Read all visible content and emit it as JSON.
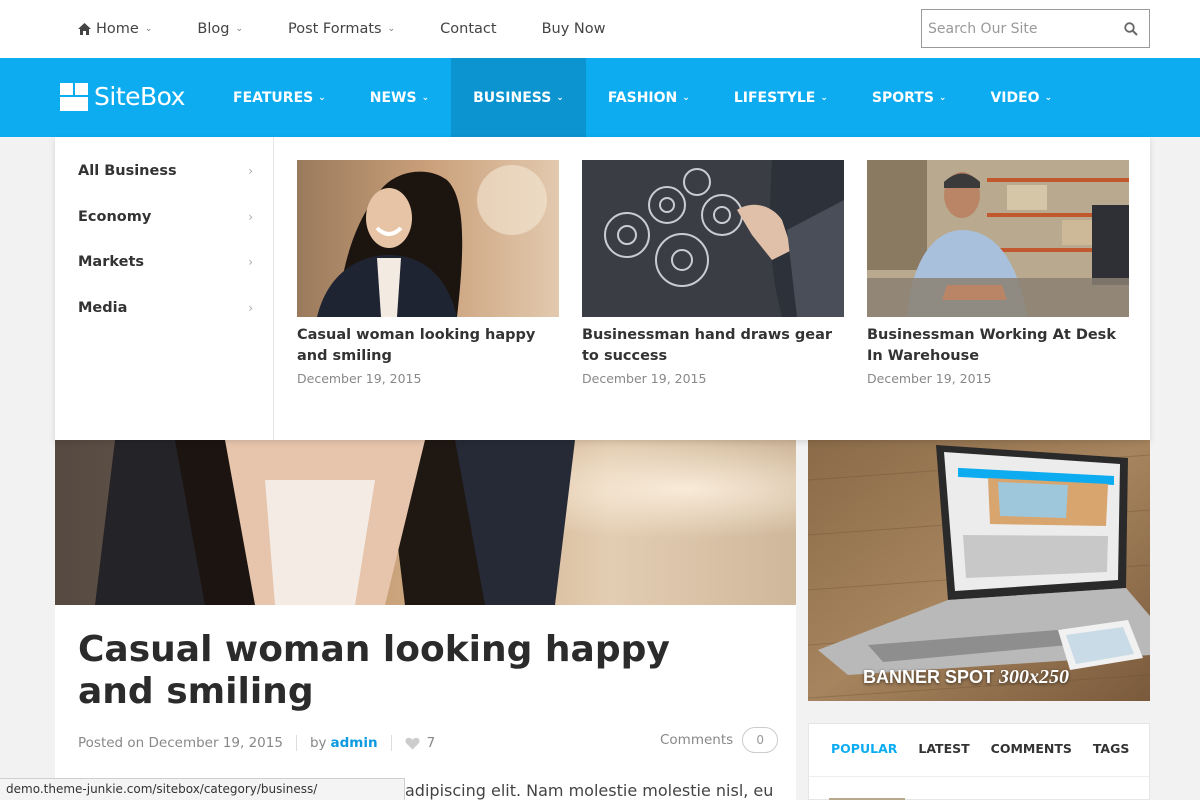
{
  "topnav": {
    "items": [
      {
        "label": "Home",
        "icon": "home-icon",
        "dropdown": true
      },
      {
        "label": "Blog",
        "dropdown": true
      },
      {
        "label": "Post Formats",
        "dropdown": true
      },
      {
        "label": "Contact",
        "dropdown": false
      },
      {
        "label": "Buy Now",
        "dropdown": false
      }
    ],
    "search_placeholder": "Search Our Site"
  },
  "brand": {
    "name": "SiteBox",
    "accent": "#0dacf0",
    "active_bg": "#0b94d0"
  },
  "mainnav": {
    "items": [
      "FEATURES",
      "NEWS",
      "BUSINESS",
      "FASHION",
      "LIFESTYLE",
      "SPORTS",
      "VIDEO"
    ],
    "active": "BUSINESS"
  },
  "mega": {
    "categories": [
      "All Business",
      "Economy",
      "Markets",
      "Media"
    ],
    "posts": [
      {
        "title": "Casual woman looking happy and smiling",
        "date": "December 19, 2015"
      },
      {
        "title": "Businessman hand draws gear to success",
        "date": "December 19, 2015"
      },
      {
        "title": "Businessman Working At Desk In Warehouse",
        "date": "December 19, 2015"
      }
    ]
  },
  "article": {
    "title": "Casual woman looking happy and smiling",
    "posted": "Posted on December 19, 2015",
    "by": "by",
    "author": "admin",
    "likes": "7",
    "comments_label": "Comments",
    "comments_count": "0",
    "excerpt": "adipiscing elit. Nam molestie molestie nisl, eu"
  },
  "sidebar": {
    "banner_text": "BANNER SPOT",
    "banner_size": "300x250",
    "tabs": [
      "POPULAR",
      "LATEST",
      "COMMENTS",
      "TAGS"
    ],
    "active_tab": "POPULAR"
  },
  "status_url": "demo.theme-junkie.com/sitebox/category/business/"
}
